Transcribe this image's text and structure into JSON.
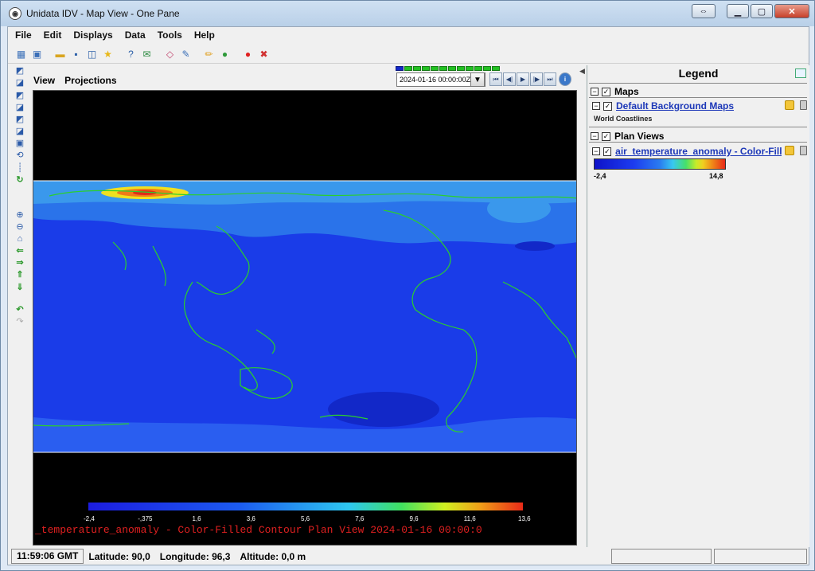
{
  "window": {
    "title": "Unidata IDV - Map View - One Pane",
    "app_icon_glyph": "IDV"
  },
  "menu": [
    "File",
    "Edit",
    "Displays",
    "Data",
    "Tools",
    "Help"
  ],
  "toolbar_icons": [
    "new-view-icon",
    "new-window-icon",
    "open-folder-icon",
    "save-icon",
    "save-all-icon",
    "favorite-star-icon",
    "help-icon",
    "mail-icon",
    "eraser-icon",
    "edit-icon",
    "pencil-icon",
    "globe-icon",
    "record-icon",
    "stop-icon"
  ],
  "view_menu": {
    "view": "View",
    "projections": "Projections"
  },
  "time": {
    "current": "2024-01-16 00:00:00Z",
    "steps": 12,
    "current_step": 1
  },
  "map": {
    "colorbar_ticks": [
      "-2,4",
      "-,375",
      "1,6",
      "3,6",
      "5,6",
      "7,6",
      "9,6",
      "11,6",
      "13,6"
    ],
    "display_label": "_temperature_anomaly - Color-Filled Contour Plan View 2024-01-16 00:00:0",
    "colors": {
      "ocean": "#1a3ce8",
      "coast": "#2bd02b",
      "label": "#e02020"
    }
  },
  "legend": {
    "title": "Legend",
    "groups": [
      {
        "name": "Maps",
        "layers": [
          {
            "name": "Default Background Maps",
            "detail": "World Coastlines"
          }
        ]
      },
      {
        "name": "Plan Views",
        "layers": [
          {
            "name": "air_temperature_anomaly - Color-Fill...",
            "range_min": "-2,4",
            "range_max": "14,8"
          }
        ]
      }
    ]
  },
  "status": {
    "time": "11:59:06 GMT",
    "latitude_label": "Latitude:",
    "latitude": "90,0",
    "longitude_label": "Longitude:",
    "longitude": "96,3",
    "altitude_label": "Altitude:",
    "altitude": "0,0 m"
  }
}
